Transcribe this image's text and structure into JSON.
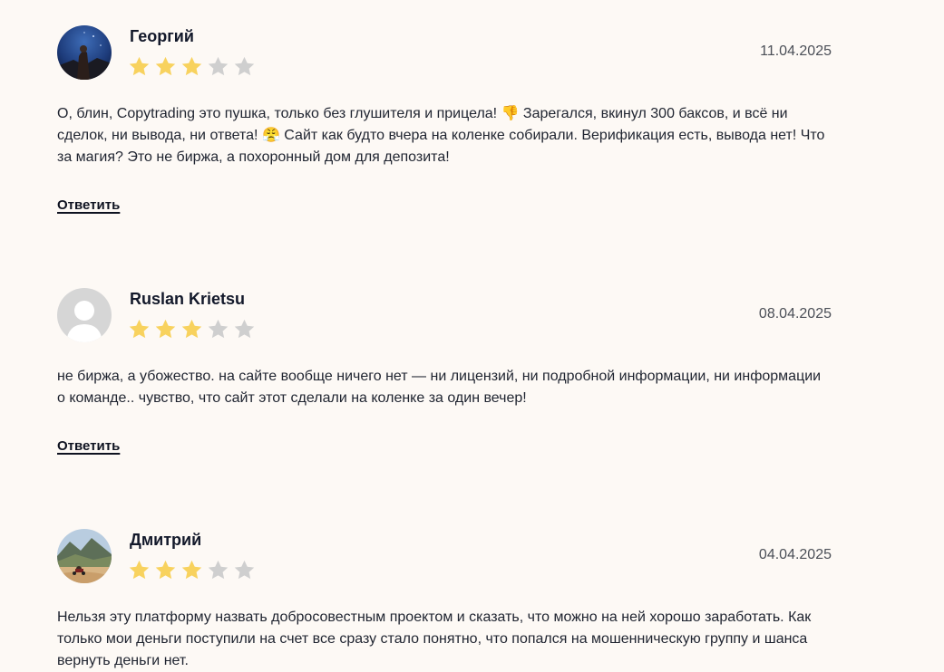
{
  "comments": [
    {
      "author": "Георгий",
      "date": "11.04.2025",
      "rating": 3,
      "max_rating": 5,
      "avatar": "night-sky-photo",
      "text": "О, блин, Copytrading это пушка, только без глушителя и прицела! 👎 Зарегался, вкинул 300 баксов, и всё ни сделок, ни вывода, ни ответа! 😤 Сайт как будто вчера на коленке собирали. Верификация есть, вывода нет! Что за магия? Это не биржа, а похоронный дом для депозита!",
      "reply_label": "Ответить"
    },
    {
      "author": "Ruslan Krietsu",
      "date": "08.04.2025",
      "rating": 3,
      "max_rating": 5,
      "avatar": "default-user-placeholder",
      "text": "не биржа, а убожество. на сайте вообще ничего нет — ни лицензий, ни подробной информации, ни информации о команде.. чувство, что сайт этот сделали на коленке за один вечер!",
      "reply_label": "Ответить"
    },
    {
      "author": "Дмитрий",
      "date": "04.04.2025",
      "rating": 3,
      "max_rating": 5,
      "avatar": "mountain-motorcycle-photo",
      "text": "Нельзя эту платформу назвать добросовестным проектом и сказать, что можно на ней хорошо заработать. Как только мои деньги поступили на счет все сразу стало понятно, что попался на мошенническую группу и шанса вернуть деньги нет."
    }
  ],
  "colors": {
    "background": "#fdf9f5",
    "star_filled": "#f8d25e",
    "star_empty": "#cfcfcf",
    "author": "#12182a",
    "date": "#4b4f57"
  }
}
